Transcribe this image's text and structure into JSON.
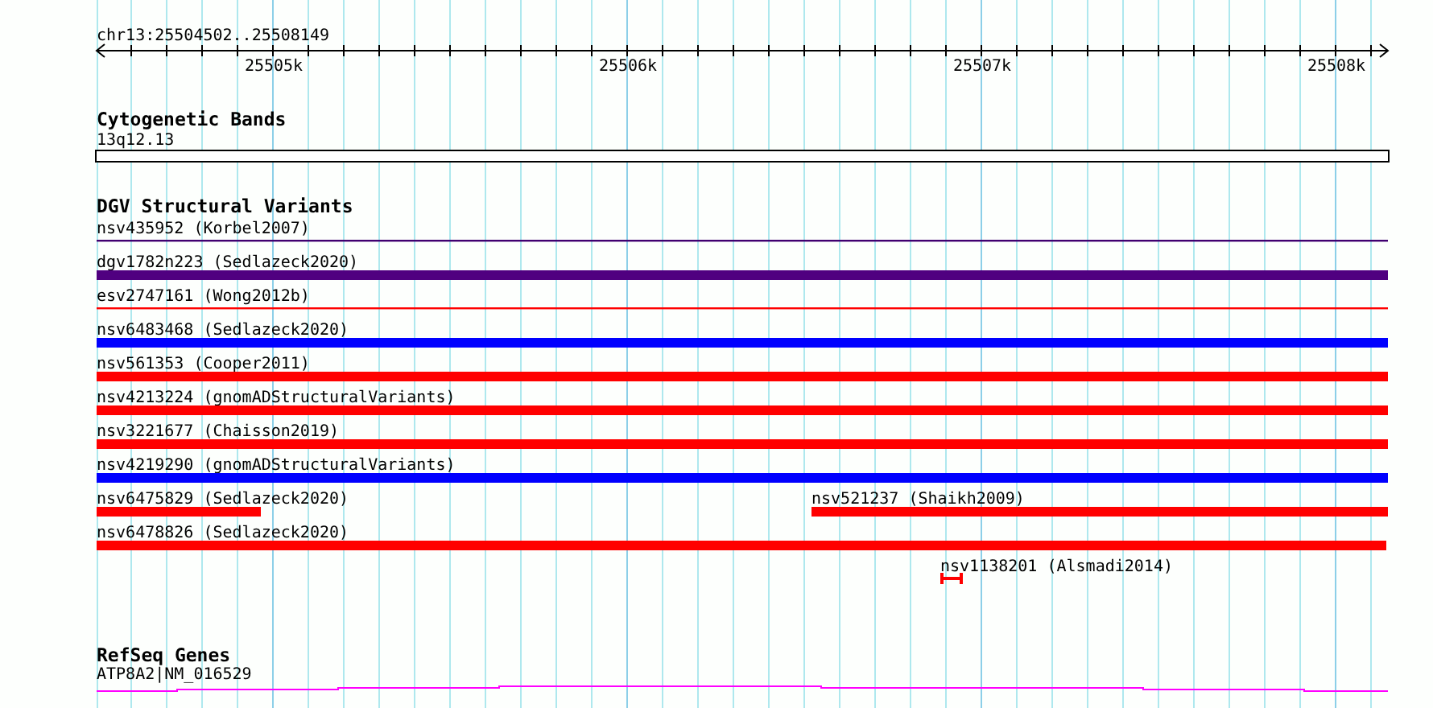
{
  "ruler": {
    "range_label": "chr13:25504502..25508149",
    "ticks": [
      "25505k",
      "25506k",
      "25507k",
      "25508k"
    ]
  },
  "cytogenetic_bands": {
    "title": "Cytogenetic Bands",
    "bands": [
      {
        "label": "13q12.13"
      }
    ]
  },
  "dgv_structural_variants": {
    "title": "DGV Structural Variants",
    "rows": [
      {
        "features": [
          {
            "label": "nsv435952 (Korbel2007)",
            "kind": "line",
            "color": "#400070"
          }
        ]
      },
      {
        "features": [
          {
            "label": "dgv1782n223 (Sedlazeck2020)",
            "kind": "bar",
            "color": "#500080"
          }
        ]
      },
      {
        "features": [
          {
            "label": "esv2747161 (Wong2012b)",
            "kind": "line",
            "color": "#ff0000"
          }
        ]
      },
      {
        "features": [
          {
            "label": "nsv6483468 (Sedlazeck2020)",
            "kind": "bar",
            "color": "#0000ff"
          }
        ]
      },
      {
        "features": [
          {
            "label": "nsv561353 (Cooper2011)",
            "kind": "bar",
            "color": "#ff0000"
          }
        ]
      },
      {
        "features": [
          {
            "label": "nsv4213224 (gnomADStructuralVariants)",
            "kind": "bar",
            "color": "#ff0000"
          }
        ]
      },
      {
        "features": [
          {
            "label": "nsv3221677 (Chaisson2019)",
            "kind": "bar",
            "color": "#ff0000"
          }
        ]
      },
      {
        "features": [
          {
            "label": "nsv4219290 (gnomADStructuralVariants)",
            "kind": "bar",
            "color": "#0000ff"
          }
        ]
      },
      {
        "features": [
          {
            "label": "nsv6475829 (Sedlazeck2020)",
            "kind": "bar",
            "color": "#ff0000"
          },
          {
            "label": "nsv521237 (Shaikh2009)",
            "kind": "bar",
            "color": "#ff0000"
          }
        ]
      },
      {
        "features": [
          {
            "label": "nsv6478826 (Sedlazeck2020)",
            "kind": "bar",
            "color": "#ff0000"
          }
        ]
      },
      {
        "features": [
          {
            "label": "nsv1138201 (Alsmadi2014)",
            "kind": "interval",
            "color": "#ff0000"
          }
        ]
      }
    ]
  },
  "refseq_genes": {
    "title": "RefSeq Genes",
    "genes": [
      {
        "label": "ATP8A2|NM_016529",
        "color": "#ff00ff"
      }
    ]
  }
}
